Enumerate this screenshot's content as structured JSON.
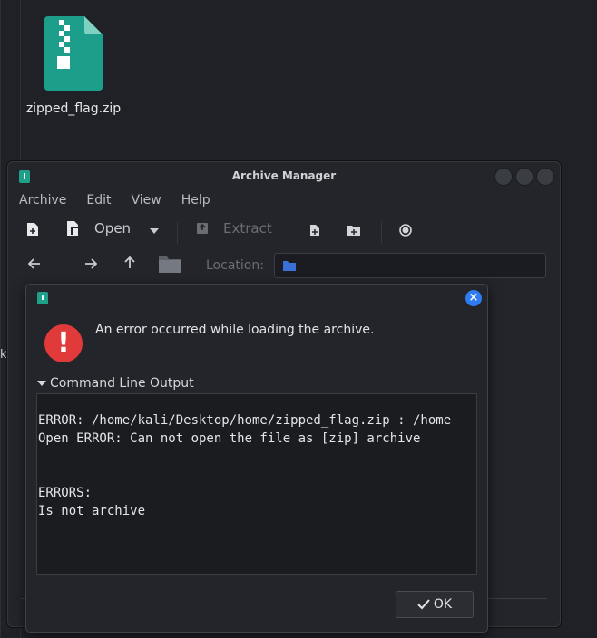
{
  "desktop": {
    "file_label": "zipped_flag.zip",
    "stray_text": "k"
  },
  "window": {
    "title": "Archive Manager",
    "menu": [
      "Archive",
      "Edit",
      "View",
      "Help"
    ],
    "toolbar": {
      "open_label": "Open",
      "extract_label": "Extract"
    },
    "location_label": "Location:"
  },
  "dialog": {
    "message": "An error occurred while loading the archive.",
    "expander_label": "Command Line Output",
    "output_lines": [
      "ERROR: /home/kali/Desktop/home/zipped_flag.zip : /home",
      "Open ERROR: Can not open the file as [zip] archive",
      "",
      "",
      "ERRORS:",
      "Is not archive"
    ],
    "ok_label": "OK"
  },
  "icons": {
    "archive_file": "zip-file-icon",
    "error": "error-icon",
    "close": "close-icon"
  },
  "colors": {
    "accent_teal": "#1fa088",
    "error_red": "#e03a3a",
    "close_blue": "#2f7bf0"
  }
}
